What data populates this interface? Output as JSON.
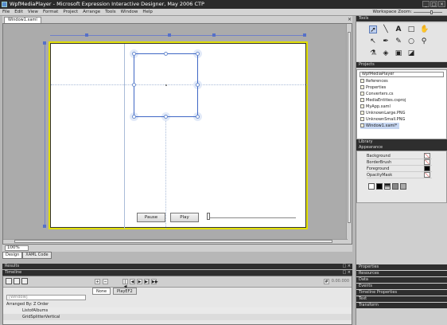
{
  "window": {
    "title": "WpfMediaPlayer - Microsoft Expression Interactive Designer, May 2006 CTP",
    "buttons": [
      "_",
      "□",
      "×"
    ]
  },
  "menu": [
    "File",
    "Edit",
    "View",
    "Format",
    "Project",
    "Arrange",
    "Tools",
    "Window",
    "Help"
  ],
  "workspace_zoom_label": "Workspace Zoom:",
  "document_tab": "Window1.xaml",
  "design": {
    "pause_label": "Pause",
    "play_label": "Play",
    "media_slider_value": 0.0
  },
  "zoom": {
    "value": "100%",
    "view_tabs": [
      "Design",
      "XAML Code"
    ]
  },
  "panels": {
    "results": "Results",
    "timeline": "Timeline",
    "tools": "Tools",
    "projects": "Projects",
    "library": "Library",
    "appearance": "Appearance",
    "collapsed": [
      "Properties",
      "Resources",
      "Data",
      "Events",
      "Timeline Properties",
      "Text",
      "Transform"
    ]
  },
  "timeline": {
    "time": "0.00.000",
    "tabs": [
      "None",
      "PlayEF2"
    ],
    "filter_placeholder": "[Window]",
    "arranged_label": "Arranged By: Z Order",
    "rows": [
      "ListofAlbums",
      "GridSplitterVertical"
    ]
  },
  "projects": {
    "combo": "WpfMediaPlayer",
    "items": [
      "References",
      "Properties",
      "Converters.cs",
      "MediaEntities.csproj",
      "MyApp.xaml",
      "UnknownLarge.PNG",
      "UnknownSmall.PNG",
      "Window1.xaml*"
    ]
  },
  "appearance": {
    "properties": [
      "Background",
      "BorderBrush",
      "Foreground",
      "OpacityMask"
    ]
  },
  "icons": [
    "select-icon",
    "line-icon",
    "text-icon",
    "rectangle-icon",
    "hand-icon",
    "direct-select-icon",
    "pen-icon",
    "pencil-icon",
    "brush-icon",
    "ellipse-icon",
    "zoom-icon",
    "eyedropper-icon",
    "paint-bucket-icon",
    "camera-icon",
    "cube-icon"
  ]
}
